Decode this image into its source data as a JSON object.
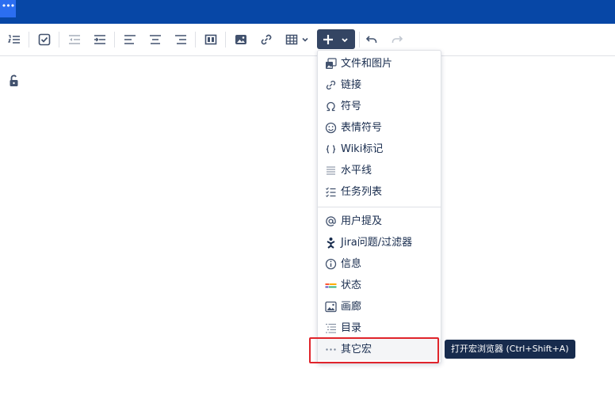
{
  "topbar": {
    "menu_glyph": "•••"
  },
  "toolbar": {
    "icons": [
      "numbered-list-icon",
      "task-list-icon",
      "outdent-icon",
      "indent-icon",
      "align-left-icon",
      "align-center-icon",
      "align-right-icon",
      "page-layout-icon",
      "image-icon",
      "link-icon",
      "table-icon",
      "insert-plus-icon",
      "undo-icon",
      "redo-icon"
    ]
  },
  "insert_menu": {
    "items": [
      {
        "label": "文件和图片",
        "icon": "file-image-icon"
      },
      {
        "label": "链接",
        "icon": "link-icon"
      },
      {
        "label": "符号",
        "icon": "omega-icon"
      },
      {
        "label": "表情符号",
        "icon": "emoji-icon"
      },
      {
        "label": "Wiki标记",
        "icon": "braces-icon"
      },
      {
        "label": "水平线",
        "icon": "horizontal-rule-icon"
      },
      {
        "label": "任务列表",
        "icon": "task-list-icon"
      },
      {
        "label": "用户提及",
        "icon": "at-icon"
      },
      {
        "label": "Jira问题/过滤器",
        "icon": "jira-icon"
      },
      {
        "label": "信息",
        "icon": "info-icon"
      },
      {
        "label": "状态",
        "icon": "status-icon"
      },
      {
        "label": "画廊",
        "icon": "gallery-icon"
      },
      {
        "label": "目录",
        "icon": "toc-icon"
      },
      {
        "label": "其它宏",
        "icon": "more-icon"
      }
    ]
  },
  "tooltip": {
    "text": "打开宏浏览器 (Ctrl+Shift+A)"
  },
  "colors": {
    "topbar": "#0747a6",
    "insert_button": "#344563",
    "highlight": "#e0242b",
    "tooltip": "#172b4d"
  }
}
